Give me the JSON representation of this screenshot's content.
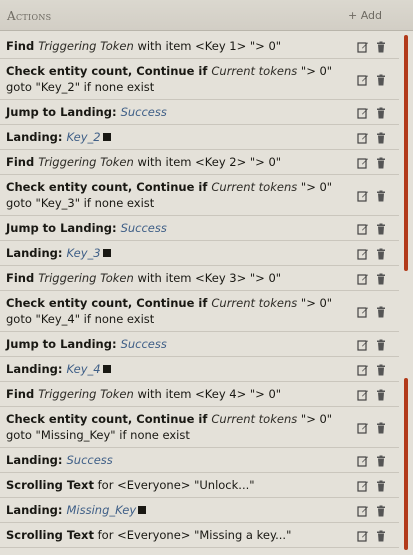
{
  "header": {
    "title": "Actions",
    "add_label": "+ Add"
  },
  "rows": [
    {
      "parts": [
        {
          "t": "Find ",
          "c": "kw"
        },
        {
          "t": "Triggering Token",
          "c": "it"
        },
        {
          "t": " with item <Key 1> \"> 0\"",
          "c": "pl"
        }
      ]
    },
    {
      "parts": [
        {
          "t": "Check entity count, Continue if ",
          "c": "kw"
        },
        {
          "t": "Current tokens",
          "c": "it"
        },
        {
          "t": " \"> 0\" goto \"Key_2\" if none exist",
          "c": "pl"
        }
      ]
    },
    {
      "parts": [
        {
          "t": "Jump to Landing: ",
          "c": "kw"
        },
        {
          "t": "Success",
          "c": "link"
        }
      ]
    },
    {
      "parts": [
        {
          "t": "Landing: ",
          "c": "kw"
        },
        {
          "t": "Key_2",
          "c": "link"
        },
        {
          "t": "",
          "c": "sq"
        }
      ]
    },
    {
      "parts": [
        {
          "t": "Find ",
          "c": "kw"
        },
        {
          "t": "Triggering Token",
          "c": "it"
        },
        {
          "t": " with item <Key 2> \"> 0\"",
          "c": "pl"
        }
      ]
    },
    {
      "parts": [
        {
          "t": "Check entity count, Continue if ",
          "c": "kw"
        },
        {
          "t": "Current tokens",
          "c": "it"
        },
        {
          "t": " \"> 0\" goto \"Key_3\" if none exist",
          "c": "pl"
        }
      ]
    },
    {
      "parts": [
        {
          "t": "Jump to Landing: ",
          "c": "kw"
        },
        {
          "t": "Success",
          "c": "link"
        }
      ]
    },
    {
      "parts": [
        {
          "t": "Landing: ",
          "c": "kw"
        },
        {
          "t": "Key_3",
          "c": "link"
        },
        {
          "t": "",
          "c": "sq"
        }
      ]
    },
    {
      "parts": [
        {
          "t": "Find ",
          "c": "kw"
        },
        {
          "t": "Triggering Token",
          "c": "it"
        },
        {
          "t": " with item <Key 3> \"> 0\"",
          "c": "pl"
        }
      ]
    },
    {
      "parts": [
        {
          "t": "Check entity count, Continue if ",
          "c": "kw"
        },
        {
          "t": "Current tokens",
          "c": "it"
        },
        {
          "t": " \"> 0\" goto \"Key_4\" if none exist",
          "c": "pl"
        }
      ]
    },
    {
      "parts": [
        {
          "t": "Jump to Landing: ",
          "c": "kw"
        },
        {
          "t": "Success",
          "c": "link"
        }
      ]
    },
    {
      "parts": [
        {
          "t": "Landing: ",
          "c": "kw"
        },
        {
          "t": "Key_4",
          "c": "link"
        },
        {
          "t": "",
          "c": "sq"
        }
      ]
    },
    {
      "parts": [
        {
          "t": "Find ",
          "c": "kw"
        },
        {
          "t": "Triggering Token",
          "c": "it"
        },
        {
          "t": " with item <Key 4> \"> 0\"",
          "c": "pl"
        }
      ]
    },
    {
      "parts": [
        {
          "t": "Check entity count, Continue if ",
          "c": "kw"
        },
        {
          "t": "Current tokens",
          "c": "it"
        },
        {
          "t": " \"> 0\" goto \"Missing_Key\" if none exist",
          "c": "pl"
        }
      ]
    },
    {
      "parts": [
        {
          "t": "Landing: ",
          "c": "kw"
        },
        {
          "t": "Success",
          "c": "link"
        }
      ]
    },
    {
      "parts": [
        {
          "t": "Scrolling Text",
          "c": "kw"
        },
        {
          "t": " for <Everyone> \"Unlock...\"",
          "c": "pl"
        }
      ]
    },
    {
      "parts": [
        {
          "t": "Landing: ",
          "c": "kw"
        },
        {
          "t": "Missing_Key",
          "c": "link"
        },
        {
          "t": "",
          "c": "sq"
        }
      ]
    },
    {
      "parts": [
        {
          "t": "Scrolling Text",
          "c": "kw"
        },
        {
          "t": " for <Everyone> \"Missing a key...\"",
          "c": "pl"
        }
      ]
    }
  ],
  "icons": {
    "edit": "edit-icon",
    "delete": "trash-icon"
  },
  "colors": {
    "accent_scrollbar": "#b23a1a",
    "link": "#3f5f87",
    "background": "#e4e1d9"
  }
}
